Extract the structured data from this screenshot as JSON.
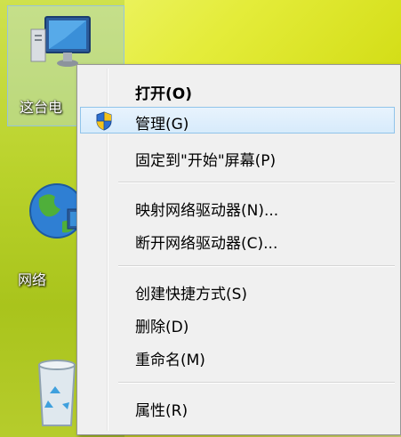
{
  "desktop": {
    "icons": [
      {
        "label": "这台电",
        "icon": "computer-icon"
      },
      {
        "label": "网络",
        "icon": "network-globe-icon"
      },
      {
        "label": "",
        "icon": "recycle-bin-icon"
      }
    ]
  },
  "context_menu": {
    "items": [
      {
        "label": "打开(O)",
        "bold": true
      },
      {
        "label": "管理(G)",
        "icon": "uac-shield-icon",
        "highlighted": true
      },
      {
        "label": "固定到\"开始\"屏幕(P)"
      },
      {
        "label": "映射网络驱动器(N)..."
      },
      {
        "label": "断开网络驱动器(C)..."
      },
      {
        "label": "创建快捷方式(S)"
      },
      {
        "label": "删除(D)"
      },
      {
        "label": "重命名(M)"
      },
      {
        "label": "属性(R)"
      }
    ]
  },
  "colors": {
    "menu_bg": "#f0f0f0",
    "highlight_border": "#90c4ea",
    "highlight_fill": "#dbedfc",
    "desktop_accent": "#dfe742"
  }
}
